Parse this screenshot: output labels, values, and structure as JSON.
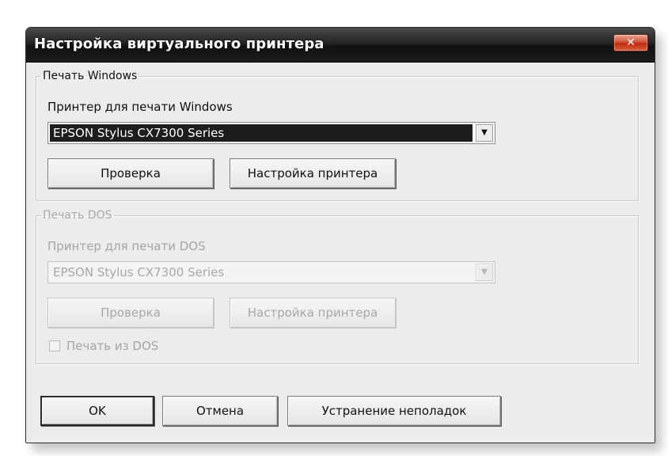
{
  "window": {
    "title": "Настройка виртуального принтера",
    "close_glyph": "✕"
  },
  "windows_print": {
    "legend": "Печать Windows",
    "printer_label": "Принтер для печати Windows",
    "printer_selected": "EPSON Stylus CX7300 Series",
    "check_button": "Проверка",
    "settings_button": "Настройка принтера"
  },
  "dos_print": {
    "legend": "Печать DOS",
    "printer_label": "Принтер для печати DOS",
    "printer_selected": "EPSON Stylus CX7300 Series",
    "check_button": "Проверка",
    "settings_button": "Настройка принтера",
    "print_from_dos_label": "Печать из DOS",
    "print_from_dos_checked": false,
    "enabled": false
  },
  "footer": {
    "ok_button": "OK",
    "cancel_button": "Отмена",
    "troubleshoot_button": "Устранение неполадок"
  },
  "icons": {
    "dropdown_arrow": "▼"
  },
  "colors": {
    "titlebar": "#1c1c1c",
    "close_button": "#c8381a",
    "selection": "#1d1d1d",
    "dialog_bg": "#ececec"
  }
}
